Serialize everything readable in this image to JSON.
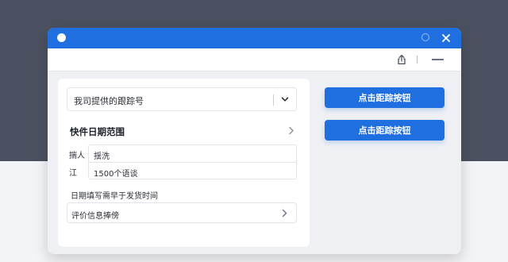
{
  "window": {
    "accent_color": "#1f6fe0"
  },
  "form": {
    "tracking_select_label": "我司提供的跟踪号",
    "section_title": "快件日期范围",
    "fields": [
      {
        "label": "揣人",
        "value": "揺洗"
      },
      {
        "label": "江",
        "value": "1500个语谈"
      }
    ],
    "date_note": "日期填写需早于发货时间",
    "review_label": "评价信息捧傍"
  },
  "actions": {
    "track_button_1": "点击距踪按钮",
    "track_button_2": "点击距踪按钮"
  },
  "icons": {
    "app": "app-dot-icon",
    "restore": "restore-icon",
    "close": "close-icon",
    "share": "share-icon",
    "minimize": "minimize-icon",
    "dropdown": "chevron-down-icon",
    "section": "chevron-right-icon",
    "review": "chevron-right-icon"
  }
}
